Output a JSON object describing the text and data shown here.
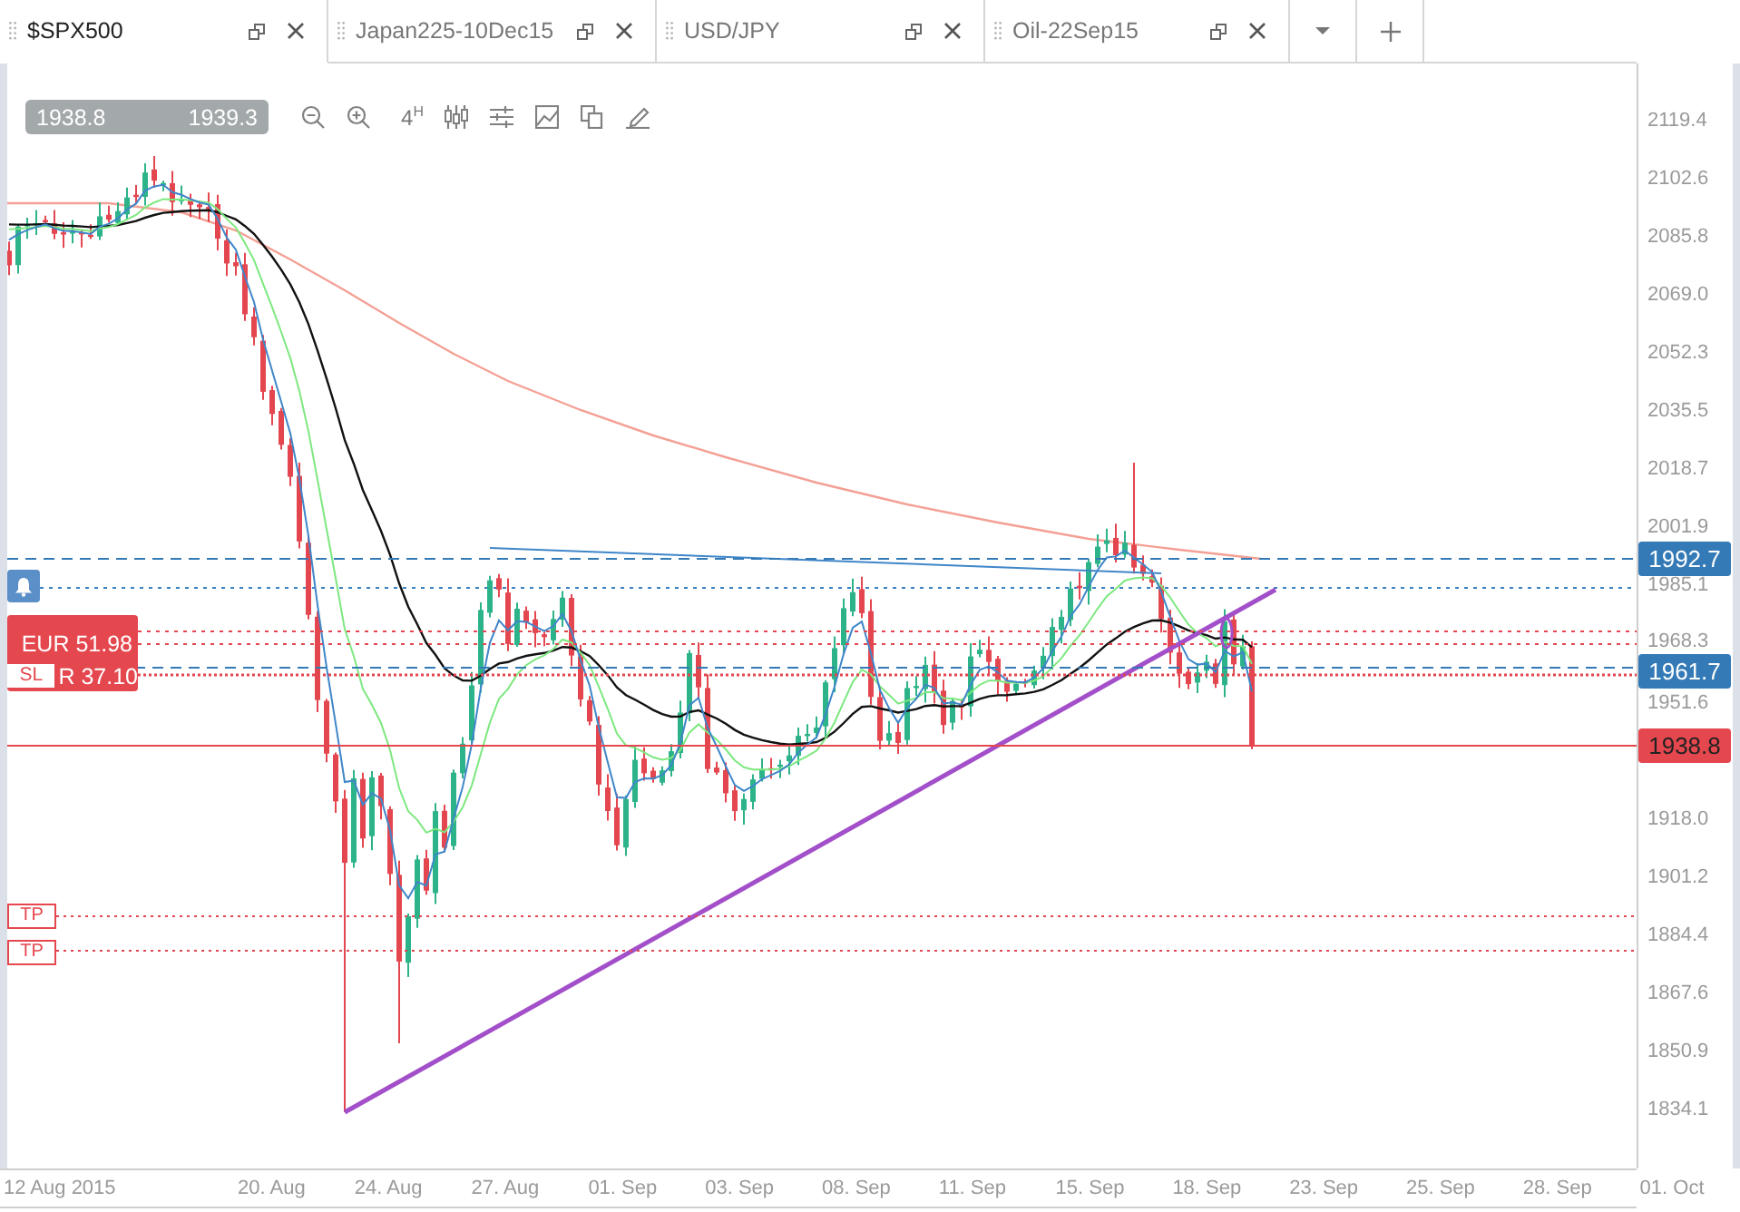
{
  "tabs": [
    {
      "label": "$SPX500",
      "selected": true
    },
    {
      "label": "Japan225-10Dec15",
      "selected": false
    },
    {
      "label": "USD/JPY",
      "selected": false
    },
    {
      "label": "Oil-22Sep15",
      "selected": false
    }
  ],
  "quote": {
    "bid": "1938.8",
    "ask": "1939.3"
  },
  "toolbar": {
    "timeframe": "4$^{H}$"
  },
  "price_axis": {
    "ticks": [
      "2119.4",
      "2102.6",
      "2085.8",
      "2069.0",
      "2052.3",
      "2035.5",
      "2018.7",
      "2001.9",
      "1985.1",
      "1968.3",
      "1951.6",
      "1918.0",
      "1901.2",
      "1884.4",
      "1867.6",
      "1850.9",
      "1834.1"
    ],
    "labels": [
      {
        "kind": "level",
        "value": "1992.7",
        "color": "#337ab7"
      },
      {
        "kind": "level",
        "value": "1961.7",
        "color": "#337ab7"
      },
      {
        "kind": "current",
        "value": "1938.8",
        "color": "#e5474f"
      }
    ]
  },
  "orders": {
    "position": {
      "amount": "EUR 51.98"
    },
    "stop_loss": {
      "tag": "SL",
      "amount": "R 37.10"
    },
    "take_profits": [
      {
        "tag": "TP"
      },
      {
        "tag": "TP"
      }
    ]
  },
  "time_axis": {
    "ticks": [
      "12 Aug 2015",
      "20. Aug",
      "24. Aug",
      "27. Aug",
      "01. Sep",
      "03. Sep",
      "08. Sep",
      "11. Sep",
      "15. Sep",
      "18. Sep",
      "23. Sep",
      "25. Sep",
      "28. Sep",
      "01. Oct"
    ]
  }
}
